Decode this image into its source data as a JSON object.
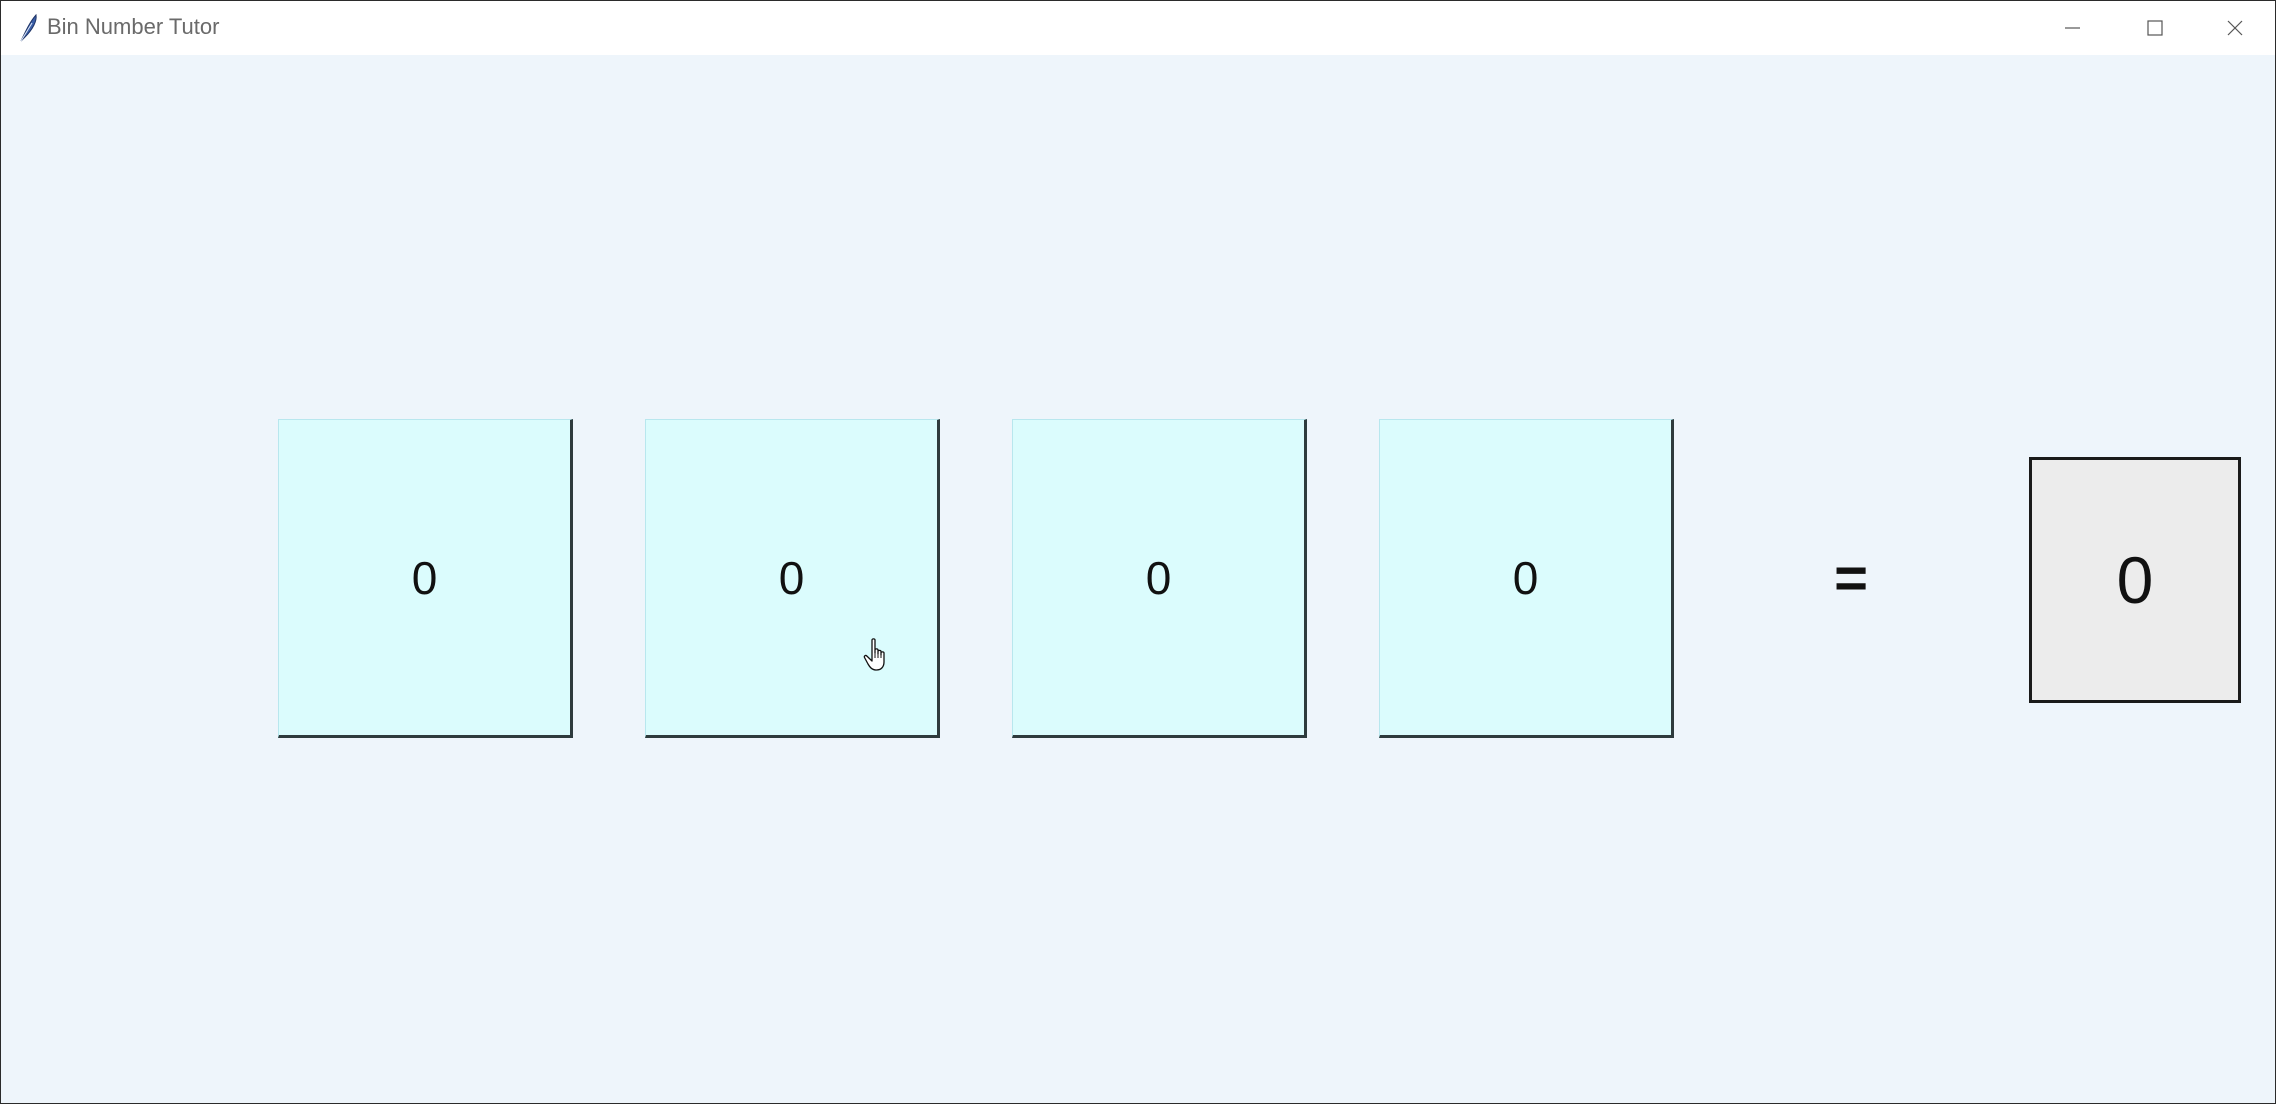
{
  "window": {
    "title": "Bin Number Tutor",
    "icon": "feather-icon",
    "controls": [
      "minimize-icon",
      "maximize-icon",
      "close-icon"
    ]
  },
  "bits": [
    {
      "label": "0"
    },
    {
      "label": "0"
    },
    {
      "label": "0"
    },
    {
      "label": "0"
    }
  ],
  "equals_sign": "=",
  "result": {
    "value": "0"
  },
  "colors": {
    "bit_button_bg": "#dbfcfd",
    "window_bg": "#eef5fb",
    "result_bg": "#ececec"
  }
}
